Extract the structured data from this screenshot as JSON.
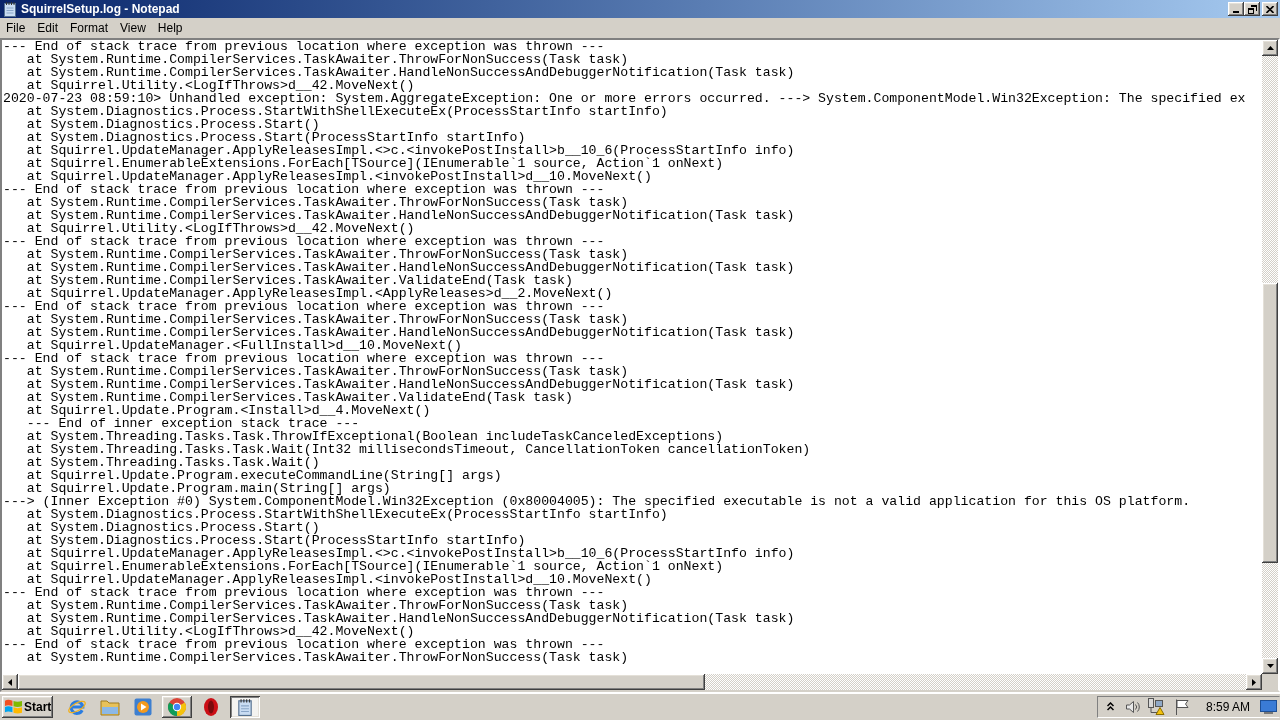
{
  "window": {
    "title": "SquirrelSetup.log - Notepad"
  },
  "menu": [
    "File",
    "Edit",
    "Format",
    "View",
    "Help"
  ],
  "document": {
    "lines": [
      "--- End of stack trace from previous location where exception was thrown ---",
      "   at System.Runtime.CompilerServices.TaskAwaiter.ThrowForNonSuccess(Task task)",
      "   at System.Runtime.CompilerServices.TaskAwaiter.HandleNonSuccessAndDebuggerNotification(Task task)",
      "   at Squirrel.Utility.<LogIfThrows>d__42.MoveNext()",
      "2020-07-23 08:59:10> Unhandled exception: System.AggregateException: One or more errors occurred. ---> System.ComponentModel.Win32Exception: The specified ex",
      "   at System.Diagnostics.Process.StartWithShellExecuteEx(ProcessStartInfo startInfo)",
      "   at System.Diagnostics.Process.Start()",
      "   at System.Diagnostics.Process.Start(ProcessStartInfo startInfo)",
      "   at Squirrel.UpdateManager.ApplyReleasesImpl.<>c.<invokePostInstall>b__10_6(ProcessStartInfo info)",
      "   at Squirrel.EnumerableExtensions.ForEach[TSource](IEnumerable`1 source, Action`1 onNext)",
      "   at Squirrel.UpdateManager.ApplyReleasesImpl.<invokePostInstall>d__10.MoveNext()",
      "--- End of stack trace from previous location where exception was thrown ---",
      "   at System.Runtime.CompilerServices.TaskAwaiter.ThrowForNonSuccess(Task task)",
      "   at System.Runtime.CompilerServices.TaskAwaiter.HandleNonSuccessAndDebuggerNotification(Task task)",
      "   at Squirrel.Utility.<LogIfThrows>d__42.MoveNext()",
      "--- End of stack trace from previous location where exception was thrown ---",
      "   at System.Runtime.CompilerServices.TaskAwaiter.ThrowForNonSuccess(Task task)",
      "   at System.Runtime.CompilerServices.TaskAwaiter.HandleNonSuccessAndDebuggerNotification(Task task)",
      "   at System.Runtime.CompilerServices.TaskAwaiter.ValidateEnd(Task task)",
      "   at Squirrel.UpdateManager.ApplyReleasesImpl.<ApplyReleases>d__2.MoveNext()",
      "--- End of stack trace from previous location where exception was thrown ---",
      "   at System.Runtime.CompilerServices.TaskAwaiter.ThrowForNonSuccess(Task task)",
      "   at System.Runtime.CompilerServices.TaskAwaiter.HandleNonSuccessAndDebuggerNotification(Task task)",
      "   at Squirrel.UpdateManager.<FullInstall>d__10.MoveNext()",
      "--- End of stack trace from previous location where exception was thrown ---",
      "   at System.Runtime.CompilerServices.TaskAwaiter.ThrowForNonSuccess(Task task)",
      "   at System.Runtime.CompilerServices.TaskAwaiter.HandleNonSuccessAndDebuggerNotification(Task task)",
      "   at System.Runtime.CompilerServices.TaskAwaiter.ValidateEnd(Task task)",
      "   at Squirrel.Update.Program.<Install>d__4.MoveNext()",
      "   --- End of inner exception stack trace ---",
      "   at System.Threading.Tasks.Task.ThrowIfExceptional(Boolean includeTaskCanceledExceptions)",
      "   at System.Threading.Tasks.Task.Wait(Int32 millisecondsTimeout, CancellationToken cancellationToken)",
      "   at System.Threading.Tasks.Task.Wait()",
      "   at Squirrel.Update.Program.executeCommandLine(String[] args)",
      "   at Squirrel.Update.Program.main(String[] args)",
      "---> (Inner Exception #0) System.ComponentModel.Win32Exception (0x80004005): The specified executable is not a valid application for this OS platform.",
      "   at System.Diagnostics.Process.StartWithShellExecuteEx(ProcessStartInfo startInfo)",
      "   at System.Diagnostics.Process.Start()",
      "   at System.Diagnostics.Process.Start(ProcessStartInfo startInfo)",
      "   at Squirrel.UpdateManager.ApplyReleasesImpl.<>c.<invokePostInstall>b__10_6(ProcessStartInfo info)",
      "   at Squirrel.EnumerableExtensions.ForEach[TSource](IEnumerable`1 source, Action`1 onNext)",
      "   at Squirrel.UpdateManager.ApplyReleasesImpl.<invokePostInstall>d__10.MoveNext()",
      "--- End of stack trace from previous location where exception was thrown ---",
      "   at System.Runtime.CompilerServices.TaskAwaiter.ThrowForNonSuccess(Task task)",
      "   at System.Runtime.CompilerServices.TaskAwaiter.HandleNonSuccessAndDebuggerNotification(Task task)",
      "   at Squirrel.Utility.<LogIfThrows>d__42.MoveNext()",
      "--- End of stack trace from previous location where exception was thrown ---",
      "   at System.Runtime.CompilerServices.TaskAwaiter.ThrowForNonSuccess(Task task)"
    ]
  },
  "taskbar": {
    "start_label": "Start",
    "items": [
      {
        "kind": "launcher"
      },
      {
        "kind": "launcher"
      },
      {
        "kind": "launcher"
      },
      {
        "kind": "window",
        "selected": false
      },
      {
        "kind": "launcher"
      },
      {
        "kind": "window",
        "selected": true
      }
    ],
    "clock": "8:59 AM"
  }
}
